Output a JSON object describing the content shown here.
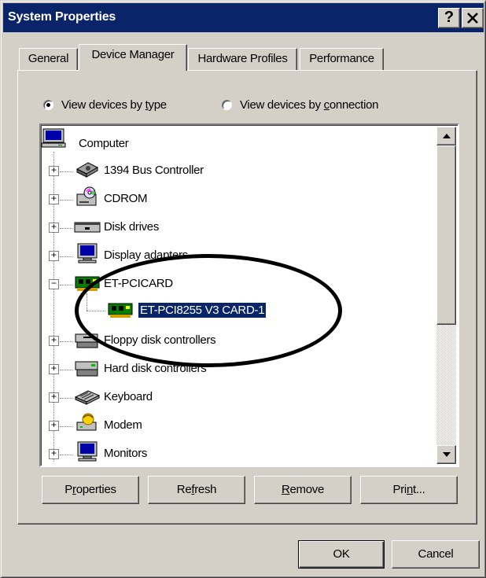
{
  "window": {
    "title": "System Properties",
    "help_glyph": "?",
    "close_glyph": "✕"
  },
  "tabs": [
    {
      "label": "General",
      "active": false
    },
    {
      "label": "Device Manager",
      "active": true
    },
    {
      "label": "Hardware Profiles",
      "active": false
    },
    {
      "label": "Performance",
      "active": false
    }
  ],
  "view_options": {
    "by_type": {
      "label_pre": "View devices by ",
      "mnemonic": "t",
      "label_post": "ype",
      "checked": true
    },
    "by_connection": {
      "label_pre": "View devices by ",
      "mnemonic": "c",
      "label_post": "onnection",
      "checked": false
    }
  },
  "tree": {
    "root": {
      "label": "Computer",
      "icon": "computer-icon"
    },
    "items": [
      {
        "label": "1394 Bus Controller",
        "icon": "bus-controller-icon",
        "expander": "+"
      },
      {
        "label": "CDROM",
        "icon": "cdrom-icon",
        "expander": "+"
      },
      {
        "label": "Disk drives",
        "icon": "disk-drive-icon",
        "expander": "+"
      },
      {
        "label": "Display adapters",
        "icon": "display-adapter-icon",
        "expander": "+"
      },
      {
        "label": "ET-PCICARD",
        "icon": "pci-card-icon",
        "expander": "−"
      },
      {
        "label": "ET-PCI8255 V3 CARD-1",
        "icon": "pci-card-icon",
        "selected": true,
        "child": true
      },
      {
        "label": "Floppy disk controllers",
        "icon": "floppy-controller-icon",
        "expander": "+"
      },
      {
        "label": "Hard disk controllers",
        "icon": "hard-disk-controller-icon",
        "expander": "+"
      },
      {
        "label": "Keyboard",
        "icon": "keyboard-icon",
        "expander": "+"
      },
      {
        "label": "Modem",
        "icon": "modem-icon",
        "expander": "+"
      },
      {
        "label": "Monitors",
        "icon": "monitor-icon",
        "expander": "+"
      }
    ]
  },
  "action_buttons": {
    "properties": {
      "pre": "P",
      "mnemonic": "r",
      "post": "operties"
    },
    "refresh": {
      "pre": "Re",
      "mnemonic": "f",
      "post": "resh"
    },
    "remove": {
      "pre": "",
      "mnemonic": "R",
      "post": "emove"
    },
    "print": {
      "pre": "Pri",
      "mnemonic": "n",
      "post": "t..."
    }
  },
  "dialog_buttons": {
    "ok": "OK",
    "cancel": "Cancel"
  },
  "colors": {
    "face": "#d4d0c8",
    "title_bar": "#0a246a",
    "selection": "#0a246a"
  }
}
